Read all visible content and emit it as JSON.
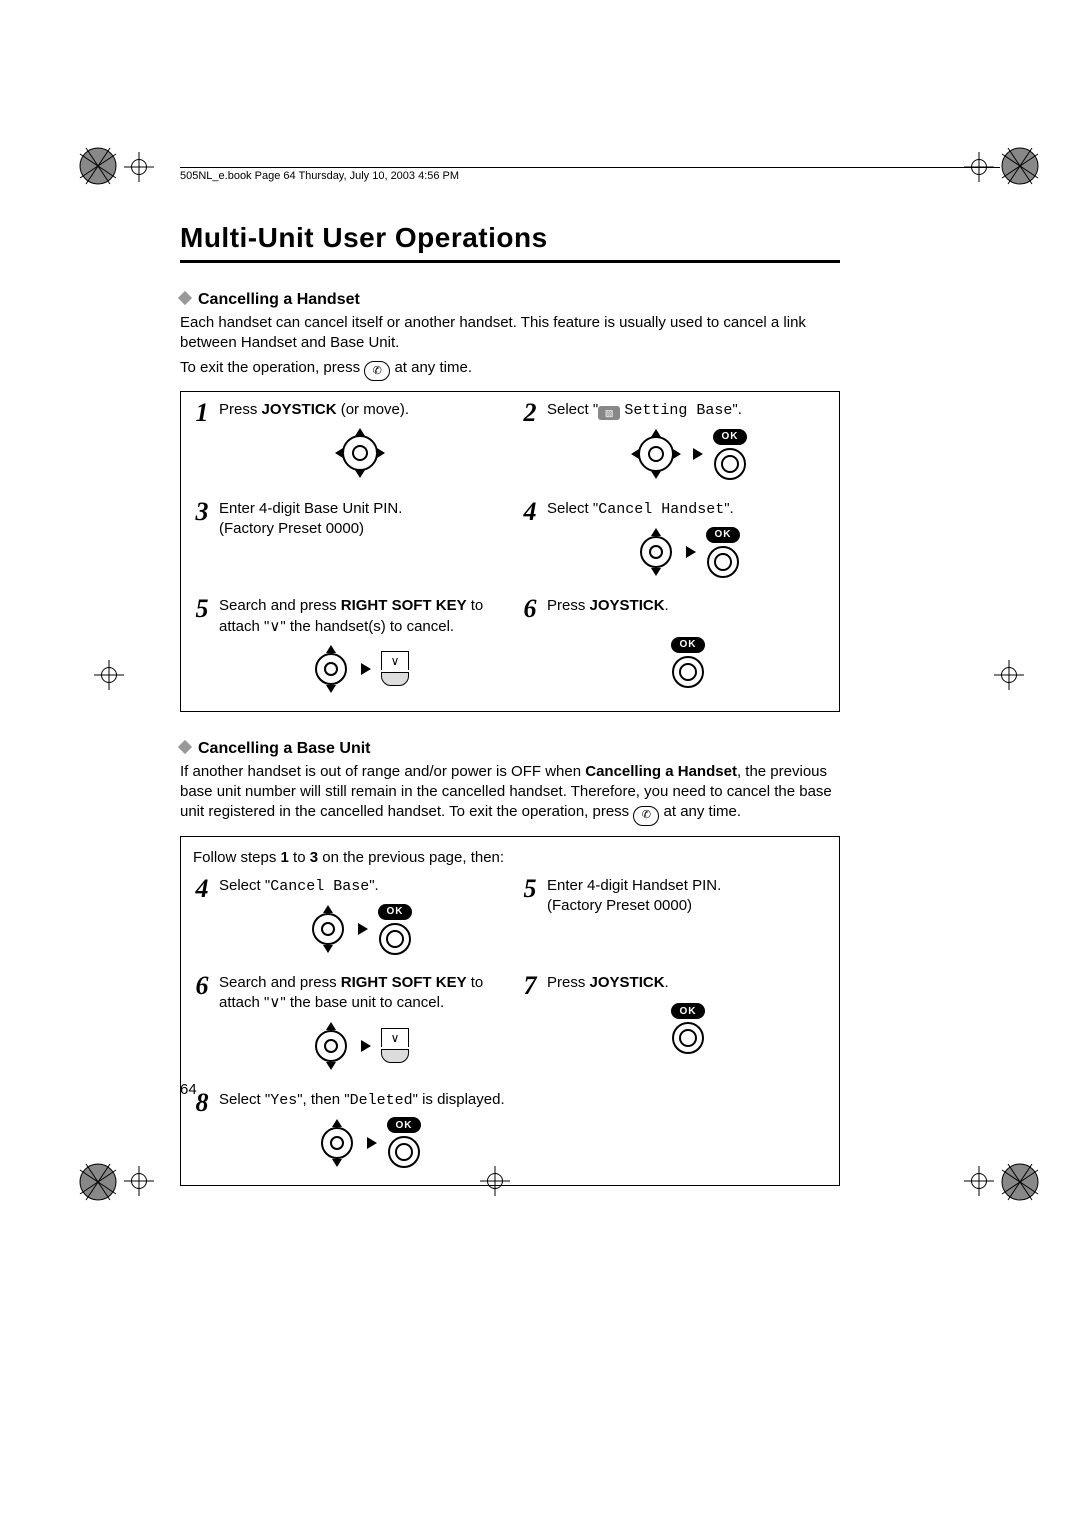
{
  "header_line": "505NL_e.book  Page 64  Thursday, July 10, 2003  4:56 PM",
  "title": "Multi-Unit User Operations",
  "page_number": "64",
  "icons": {
    "ok_label": "OK"
  },
  "section1": {
    "heading": "Cancelling a Handset",
    "para1": "Each handset can cancel itself or another handset. This feature is usually used to cancel a link between Handset and Base Unit.",
    "para2_a": "To exit the operation, press ",
    "para2_b": " at any time.",
    "steps": {
      "s1": {
        "num": "1",
        "a": "Press ",
        "b": "JOYSTICK",
        "c": " (or move)."
      },
      "s2": {
        "num": "2",
        "a": "Select \"",
        "menu": "Setting Base",
        "b": "\"."
      },
      "s3": {
        "num": "3",
        "a": "Enter 4-digit Base Unit PIN.",
        "b": "(Factory Preset 0000)"
      },
      "s4": {
        "num": "4",
        "a": "Select \"",
        "menu": "Cancel Handset",
        "b": "\"."
      },
      "s5": {
        "num": "5",
        "a": "Search and press ",
        "b": "RIGHT SOFT KEY",
        "c": " to attach \"",
        "d": "\" the handset(s) to cancel."
      },
      "s6": {
        "num": "6",
        "a": "Press ",
        "b": "JOYSTICK",
        "c": "."
      }
    }
  },
  "section2": {
    "heading": "Cancelling a Base Unit",
    "para_a": "If another handset is out of range and/or power is OFF when ",
    "para_bold": "Cancelling a Handset",
    "para_b": ", the previous base unit number will still remain in the cancelled handset. Therefore, you need to cancel the base unit registered in the cancelled handset. To exit the operation, press ",
    "para_c": " at any time.",
    "lead_a": "Follow steps ",
    "lead_b": "1",
    "lead_c": " to ",
    "lead_d": "3",
    "lead_e": " on the previous page, then:",
    "steps": {
      "s4": {
        "num": "4",
        "a": "Select \"",
        "menu": "Cancel Base",
        "b": "\"."
      },
      "s5": {
        "num": "5",
        "a": "Enter 4-digit Handset PIN.",
        "b": "(Factory Preset 0000)"
      },
      "s6": {
        "num": "6",
        "a": "Search and press ",
        "b": "RIGHT SOFT KEY",
        "c": " to attach \"",
        "d": "\" the base unit to cancel."
      },
      "s7": {
        "num": "7",
        "a": "Press ",
        "b": "JOYSTICK",
        "c": "."
      },
      "s8": {
        "num": "8",
        "a": "Select \"",
        "m1": "Yes",
        "b": "\", then \"",
        "m2": "Deleted",
        "c": "\" is displayed."
      }
    }
  }
}
